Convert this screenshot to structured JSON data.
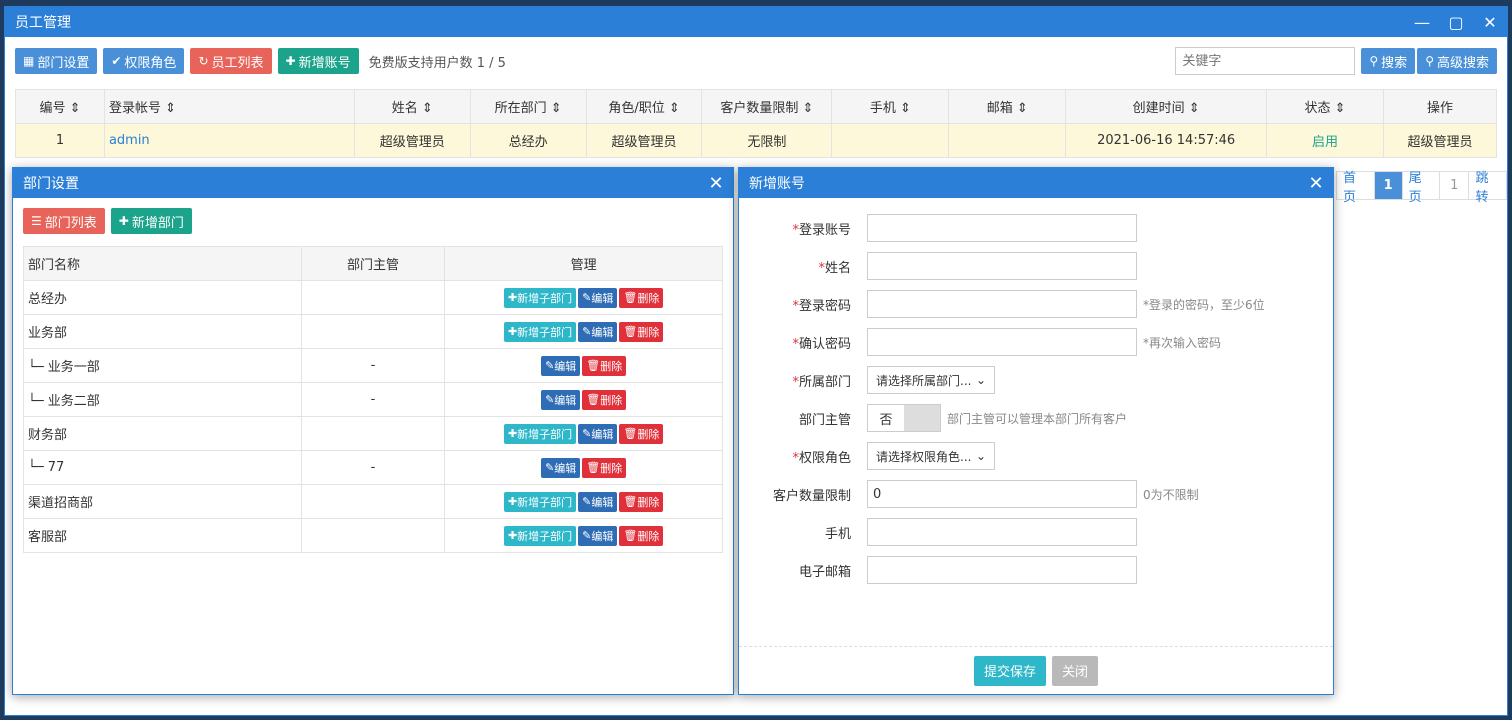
{
  "window": {
    "title": "员工管理"
  },
  "toolbar": {
    "dept_settings": "部门设置",
    "roles": "权限角色",
    "staff_list": "员工列表",
    "add_account": "新增账号",
    "user_count": "免费版支持用户数 1 / 5",
    "search_placeholder": "关键字",
    "search": "搜索",
    "advanced_search": "高级搜索"
  },
  "employee_table": {
    "headers": [
      "编号",
      "登录帐号",
      "姓名",
      "所在部门",
      "角色/职位",
      "客户数量限制",
      "手机",
      "邮箱",
      "创建时间",
      "状态",
      "操作"
    ],
    "rows": [
      {
        "id": "1",
        "login": "admin",
        "name": "超级管理员",
        "dept": "总经办",
        "role": "超级管理员",
        "limit": "无限制",
        "phone": "",
        "email": "",
        "created": "2021-06-16 14:57:46",
        "status": "启用",
        "ops": "超级管理员"
      }
    ]
  },
  "pager": {
    "first_partial": "首页",
    "current": "1",
    "last": "尾页",
    "page_input": "1",
    "jump": "跳转"
  },
  "dept_dialog": {
    "title": "部门设置",
    "list_btn": "部门列表",
    "add_btn": "新增部门",
    "headers": [
      "部门名称",
      "部门主管",
      "管理"
    ],
    "add_sub": "新增子部门",
    "edit": "编辑",
    "delete": "删除",
    "rows": [
      {
        "name": "总经办",
        "mgr": "",
        "sub": false
      },
      {
        "name": "业务部",
        "mgr": "",
        "sub": false
      },
      {
        "name": "└─ 业务一部",
        "mgr": "-",
        "sub": true
      },
      {
        "name": "└─ 业务二部",
        "mgr": "-",
        "sub": true
      },
      {
        "name": "财务部",
        "mgr": "",
        "sub": false
      },
      {
        "name": "└─ 77",
        "mgr": "-",
        "sub": true
      },
      {
        "name": "渠道招商部",
        "mgr": "",
        "sub": false
      },
      {
        "name": "客服部",
        "mgr": "",
        "sub": false
      }
    ]
  },
  "account_dialog": {
    "title": "新增账号",
    "login_label": "登录账号",
    "name_label": "姓名",
    "password_label": "登录密码",
    "password_hint": "*登录的密码，至少6位",
    "confirm_label": "确认密码",
    "confirm_hint": "*再次输入密码",
    "dept_label": "所属部门",
    "dept_select": "请选择所属部门...",
    "manager_label": "部门主管",
    "manager_value": "否",
    "manager_hint": "部门主管可以管理本部门所有客户",
    "role_label": "权限角色",
    "role_select": "请选择权限角色...",
    "limit_label": "客户数量限制",
    "limit_value": "0",
    "limit_hint": "0为不限制",
    "phone_label": "手机",
    "email_label": "电子邮箱",
    "submit": "提交保存",
    "close": "关闭"
  }
}
